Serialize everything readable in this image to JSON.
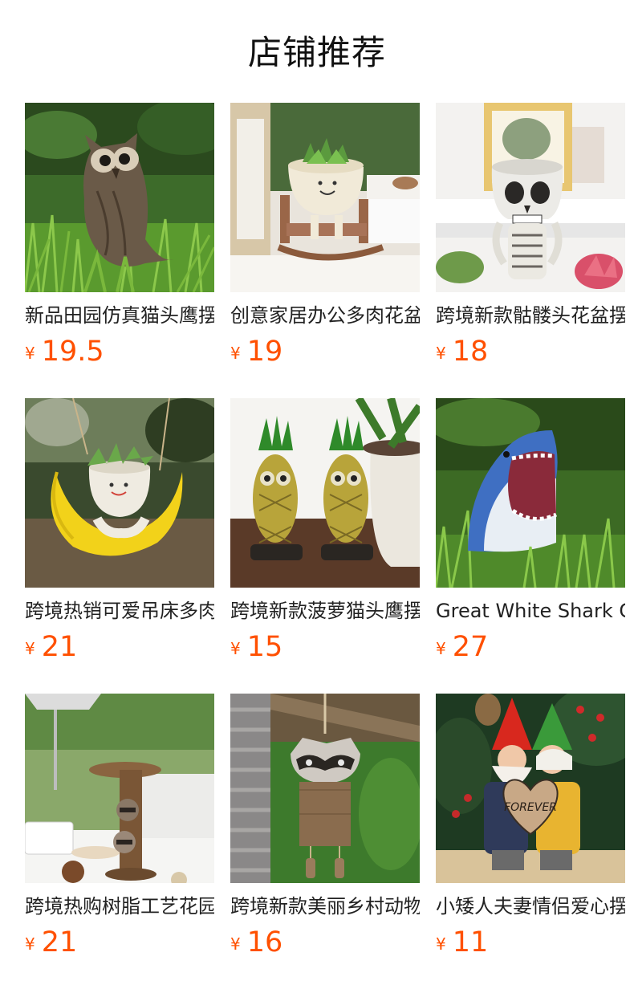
{
  "section": {
    "title": "店铺推荐"
  },
  "products": [
    {
      "name": "新品田园仿真猫头鹰摆件",
      "currency": "¥",
      "price": "19.5",
      "image": "owl-statue-on-grass"
    },
    {
      "name": "创意家居办公多肉花盆",
      "currency": "¥",
      "price": "19",
      "image": "rocking-chair-planter"
    },
    {
      "name": "跨境新款骷髅头花盆摆件",
      "currency": "¥",
      "price": "18",
      "image": "skull-planter"
    },
    {
      "name": "跨境热销可爱吊床多肉",
      "currency": "¥",
      "price": "21",
      "image": "moon-hanging-planter"
    },
    {
      "name": "跨境新款菠萝猫头鹰摆件",
      "currency": "¥",
      "price": "15",
      "image": "pineapple-owls"
    },
    {
      "name": "Great White Shark Garden Statue",
      "currency": "¥",
      "price": "27",
      "image": "shark-statue"
    },
    {
      "name": "跨境热购树脂工艺花园",
      "currency": "¥",
      "price": "21",
      "image": "raccoon-bird-feeder"
    },
    {
      "name": "跨境新款美丽乡村动物",
      "currency": "¥",
      "price": "16",
      "image": "raccoon-wind-chime"
    },
    {
      "name": "小矮人夫妻情侣爱心摆件",
      "currency": "¥",
      "price": "11",
      "image": "gnome-couple-forever"
    }
  ],
  "images": {
    "gnome_heart_text": "FOREVER"
  },
  "colors": {
    "price": "#ff5000",
    "title": "#111111",
    "name": "#222222"
  }
}
